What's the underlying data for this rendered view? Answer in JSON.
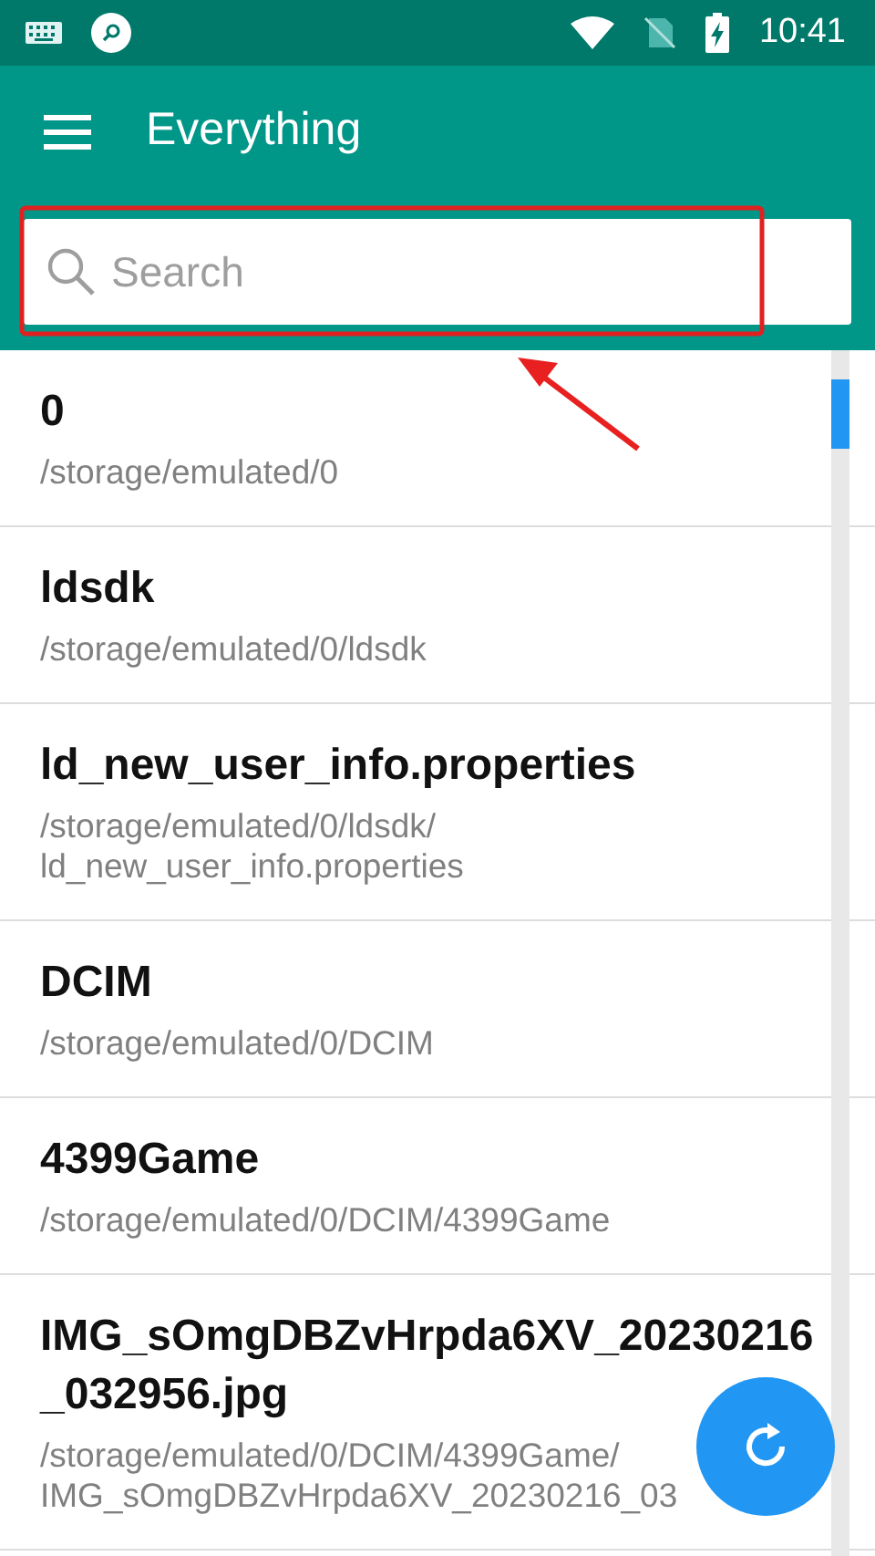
{
  "status_bar": {
    "time": "10:41"
  },
  "toolbar": {
    "title": "Everything"
  },
  "search": {
    "placeholder": "Search"
  },
  "files": [
    {
      "name": "0",
      "path": "/storage/emulated/0"
    },
    {
      "name": "ldsdk",
      "path": "/storage/emulated/0/ldsdk"
    },
    {
      "name": "ld_new_user_info.properties",
      "path": "/storage/emulated/0/ldsdk/ld_new_user_info.properties"
    },
    {
      "name": "DCIM",
      "path": "/storage/emulated/0/DCIM"
    },
    {
      "name": "4399Game",
      "path": "/storage/emulated/0/DCIM/4399Game"
    },
    {
      "name": "IMG_sOmgDBZvHrpda6XV_20230216_032956.jpg",
      "path": "/storage/emulated/0/DCIM/4399Game/IMG_sOmgDBZvHrpda6XV_20230216_03"
    }
  ],
  "annotations": {
    "highlight_box": true,
    "arrow": true
  }
}
